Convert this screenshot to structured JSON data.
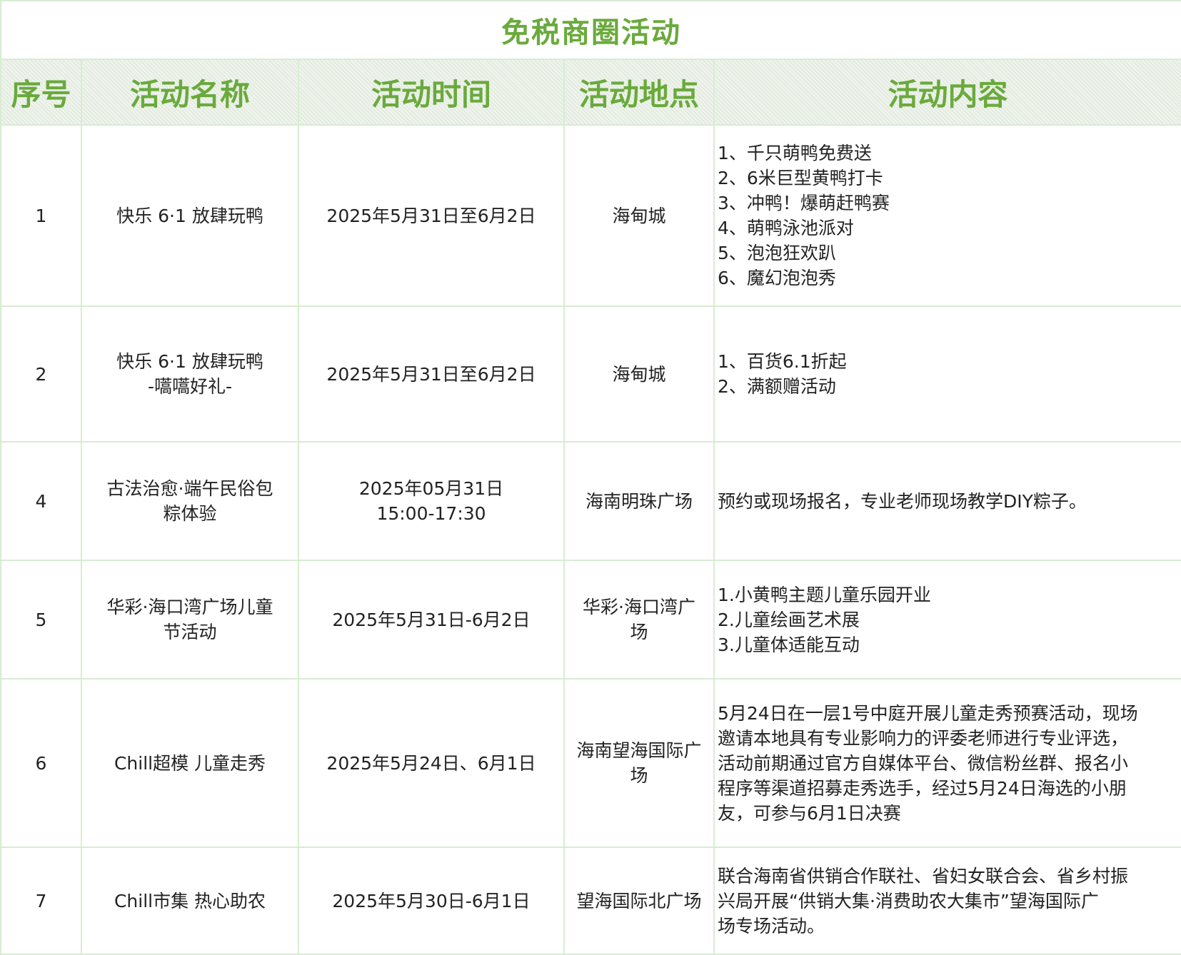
{
  "title": "免税商圈活动",
  "columns": [
    "序号",
    "活动名称",
    "活动时间",
    "活动地点",
    "活动内容"
  ],
  "rows": [
    {
      "index": "1",
      "name": [
        "快乐 6·1 放肆玩鸭"
      ],
      "time": [
        "2025年5月31日至6月2日"
      ],
      "place": [
        "海甸城"
      ],
      "content": [
        "1、千只萌鸭免费送",
        "2、6米巨型黄鸭打卡",
        "3、冲鸭！爆萌赶鸭赛",
        "4、萌鸭泳池派对",
        "5、泡泡狂欢趴",
        "6、魔幻泡泡秀"
      ]
    },
    {
      "index": "2",
      "name": [
        "快乐 6·1 放肆玩鸭",
        "-嚆嚆好礼-"
      ],
      "time": [
        "2025年5月31日至6月2日"
      ],
      "place": [
        "海甸城"
      ],
      "content": [
        "1、百货6.1折起",
        "2、满额赠活动"
      ]
    },
    {
      "index": "4",
      "name": [
        "古法治愈·端午民俗包",
        "粽体验"
      ],
      "time": [
        "2025年05月31日",
        "15:00-17:30"
      ],
      "place": [
        "海南明珠广场"
      ],
      "content": [
        "预约或现场报名，专业老师现场教学DIY粽子。"
      ]
    },
    {
      "index": "5",
      "name": [
        "华彩·海口湾广场儿童",
        "节活动"
      ],
      "time": [
        "2025年5月31日-6月2日"
      ],
      "place": [
        "华彩·海口湾广",
        "场"
      ],
      "content": [
        "1.小黄鸭主题儿童乐园开业",
        "2.儿童绘画艺术展",
        "3.儿童体适能互动"
      ]
    },
    {
      "index": "6",
      "name": [
        "Chill超模 儿童走秀"
      ],
      "time": [
        "2025年5月24日、6月1日"
      ],
      "place": [
        "海南望海国际广",
        "场"
      ],
      "content": [
        "5月24日在一层1号中庭开展儿童走秀预赛活动，现场",
        "邀请本地具有专业影响力的评委老师进行专业评选，",
        "活动前期通过官方自媒体平台、微信粉丝群、报名小",
        "程序等渠道招募走秀选手，经过5月24日海选的小朋",
        "友，可参与6月1日决赛"
      ]
    },
    {
      "index": "7",
      "name": [
        "Chill市集 热心助农"
      ],
      "time": [
        "2025年5月30日-6月1日"
      ],
      "place": [
        "望海国际北广场"
      ],
      "content": [
        "联合海南省供销合作联社、省妇女联合会、省乡村振",
        "兴局开展“供销大集·消费助农大集市”望海国际广",
        "场专场活动。"
      ]
    }
  ]
}
